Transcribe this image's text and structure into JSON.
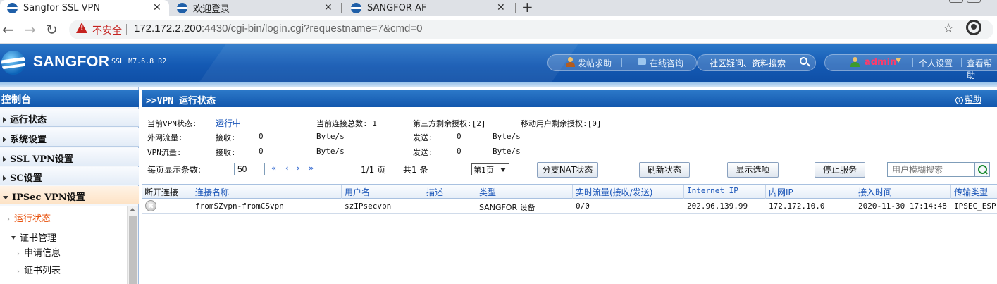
{
  "browser": {
    "tabs": [
      {
        "title": "Sangfor SSL VPN"
      },
      {
        "title": "欢迎登录"
      },
      {
        "title": "SANGFOR AF"
      }
    ],
    "insecure_label": "不安全",
    "url_host": "172.172.2.200",
    "url_rest": ":4430/cgi-bin/login.cgi?requestname=7&cmd=0"
  },
  "header": {
    "brand": "SANGFOR",
    "version": "SSL M7.6.8 R2",
    "links": {
      "post_help": "发帖求助",
      "online_consult": "在线咨询",
      "community_search": "社区疑问、资料搜索",
      "username": "admin",
      "personal_settings": "个人设置",
      "view_help": "查看帮助"
    }
  },
  "sidebar": {
    "title": "控制台",
    "items": [
      {
        "label": "运行状态"
      },
      {
        "label": "系统设置"
      },
      {
        "label": "SSL VPN设置"
      },
      {
        "label": "SC设置"
      },
      {
        "label": "IPSec VPN设置"
      }
    ],
    "tree": {
      "active": "运行状态",
      "cert_mgmt": "证书管理",
      "apply_info": "申请信息",
      "cert_list": "证书列表"
    }
  },
  "main": {
    "title": ">>VPN 运行状态",
    "help_label": "帮助",
    "status": {
      "vpn_state_label": "当前VPN状态:",
      "vpn_state_value": "运行中",
      "total_conn": "当前连接总数: 1",
      "third_party": "第三方剩余授权:[2]",
      "mobile_users": "移动用户剩余授权:[0]",
      "wan_traffic_label": "外网流量:",
      "vpn_traffic_label": "VPN流量:",
      "recv_label": "接收:",
      "send_label": "发送:",
      "zero": "0",
      "unit": "Byte/s"
    },
    "paging": {
      "per_page_label": "每页显示条数:",
      "per_page_value": "50",
      "first": "«",
      "prev": "‹",
      "next": "›",
      "last": "»",
      "page_info": "1/1 页",
      "total": "共1 条",
      "page_select": "第1页"
    },
    "buttons": {
      "branch_nat": "分支NAT状态",
      "refresh": "刷新状态",
      "display_options": "显示选项",
      "stop_service": "停止服务"
    },
    "search_placeholder": "用户模糊搜索",
    "table": {
      "columns": [
        "断开连接",
        "连接名称",
        "用户名",
        "描述",
        "类型",
        "实时流量(接收/发送)",
        "Internet IP",
        "内网IP",
        "接入时间",
        "传输类型"
      ],
      "rows": [
        {
          "name": "fromSZvpn-fromCSvpn",
          "user": "szIPsecvpn",
          "desc": "",
          "type": "SANGFOR 设备",
          "traffic": "0/0",
          "internet_ip": "202.96.139.99",
          "lan_ip": "172.172.10.0",
          "time": "2020-11-30 17:14:48",
          "transport": "IPSEC_ESP"
        }
      ]
    }
  }
}
